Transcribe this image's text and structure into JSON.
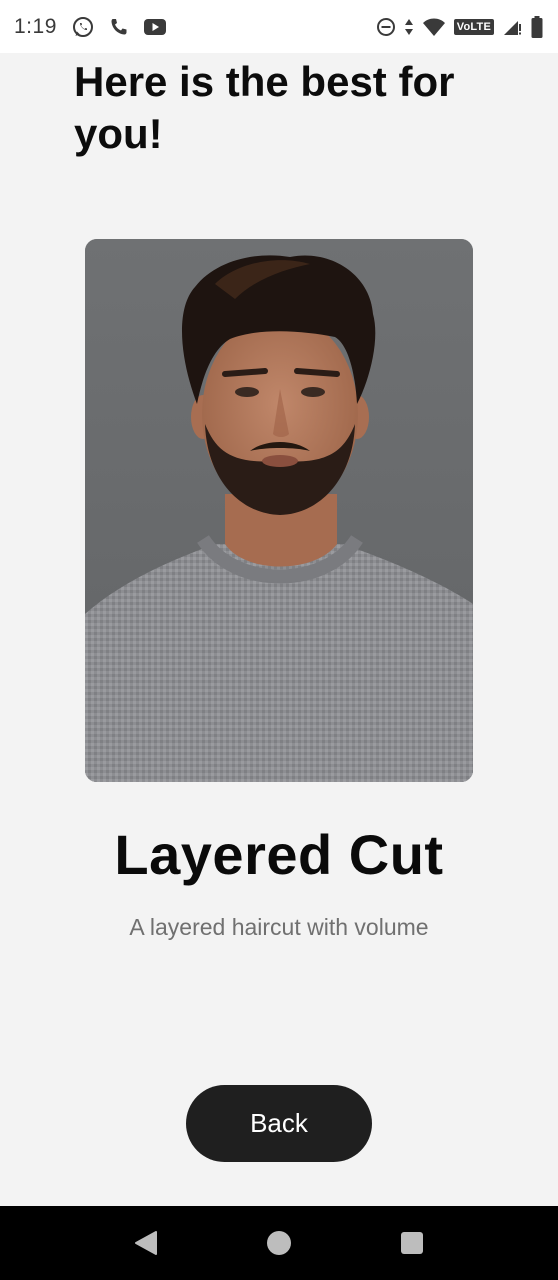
{
  "status_bar": {
    "time": "1:19",
    "network_label": "VoLTE",
    "left_icons": [
      "whatsapp-icon",
      "phone-icon",
      "youtube-icon"
    ],
    "right_icons": [
      "do-not-disturb-icon",
      "data-arrows-icon",
      "wifi-icon",
      "volte-icon",
      "signal-icon",
      "battery-icon"
    ]
  },
  "page": {
    "title": "Here is the best for you!"
  },
  "result": {
    "name": "Layered Cut",
    "description": "A layered haircut with volume",
    "photo_icon": "portrait-photo"
  },
  "actions": {
    "back_label": "Back"
  },
  "nav_bar": {
    "icons": [
      "back-triangle-icon",
      "home-circle-icon",
      "recents-square-icon"
    ]
  },
  "colors": {
    "background": "#f3f3f3",
    "button": "#1f1f1f",
    "title": "#0c0c0c",
    "description": "#707070"
  }
}
